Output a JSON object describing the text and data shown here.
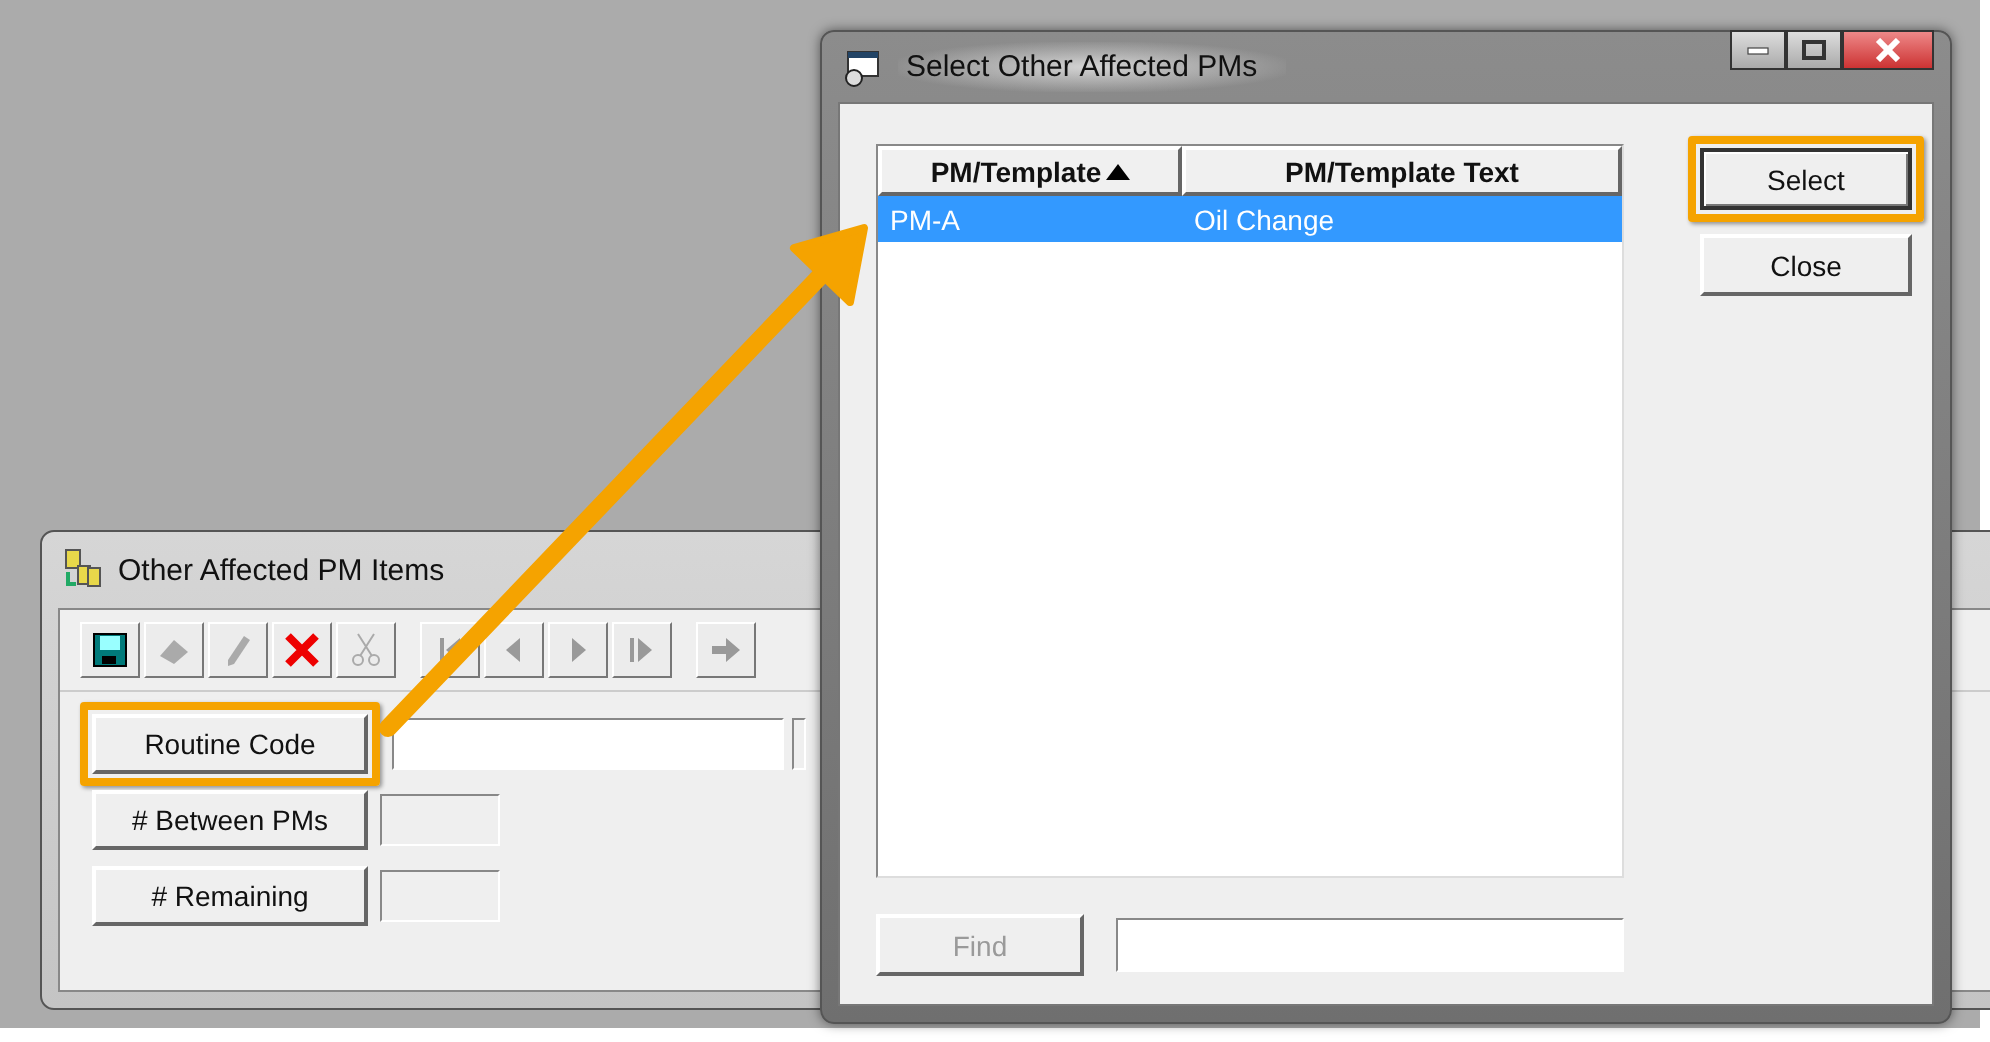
{
  "back_window": {
    "title": "Other Affected PM Items",
    "toolbar": [
      {
        "kind": "save",
        "disabled": false
      },
      {
        "kind": "stamp",
        "disabled": true
      },
      {
        "kind": "pencil",
        "disabled": true
      },
      {
        "kind": "delete",
        "disabled": false
      },
      {
        "kind": "cut",
        "disabled": true
      },
      {
        "kind": "first",
        "disabled": true
      },
      {
        "kind": "prev",
        "disabled": true
      },
      {
        "kind": "next",
        "disabled": true
      },
      {
        "kind": "last",
        "disabled": true
      },
      {
        "kind": "forward",
        "disabled": true
      }
    ],
    "fields": [
      {
        "label": "Routine Code",
        "highlighted": true,
        "wide": true
      },
      {
        "label": "# Between PMs",
        "highlighted": false,
        "wide": false
      },
      {
        "label": "# Remaining",
        "highlighted": false,
        "wide": false
      }
    ]
  },
  "dialog": {
    "title": "Select Other Affected PMs",
    "columns": [
      {
        "label": "PM/Template",
        "sorted": true
      },
      {
        "label": "PM/Template Text",
        "sorted": false
      }
    ],
    "rows": [
      {
        "cells": [
          "PM-A",
          "Oil Change"
        ],
        "selected": true
      }
    ],
    "buttons": [
      {
        "label": "Select",
        "highlighted": true
      },
      {
        "label": "Close",
        "highlighted": false
      }
    ],
    "find": {
      "label": "Find",
      "disabled": true
    }
  }
}
